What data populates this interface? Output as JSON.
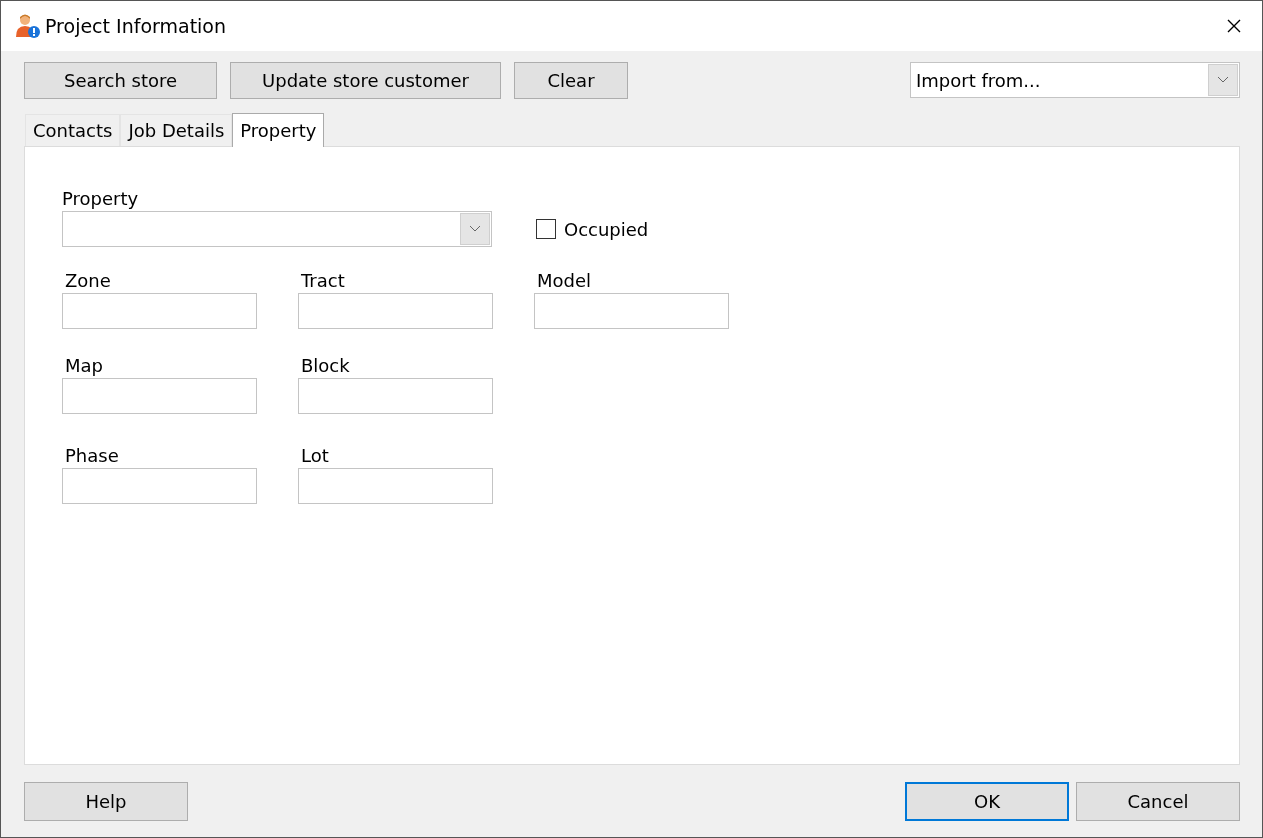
{
  "window": {
    "title": "Project Information"
  },
  "toolbar": {
    "buttons": [
      "Search store",
      "Update store customer",
      "Clear"
    ],
    "import_combo": {
      "value": "Import from..."
    }
  },
  "tabs": [
    {
      "label": "Contacts",
      "selected": false
    },
    {
      "label": "Job Details",
      "selected": false
    },
    {
      "label": "Property",
      "selected": true
    }
  ],
  "property": {
    "label": "Property"
  },
  "occupied": {
    "label": "Occupied",
    "checked": false
  },
  "field_rows": [
    [
      {
        "label": "Zone"
      },
      {
        "label": "Tract"
      },
      {
        "label": "Model"
      }
    ],
    [
      {
        "label": "Map"
      },
      {
        "label": "Block"
      }
    ],
    [
      {
        "label": "Phase"
      },
      {
        "label": "Lot"
      }
    ]
  ],
  "footer": {
    "left": [
      {
        "label": "Help",
        "focused": false
      }
    ],
    "right": [
      {
        "label": "OK",
        "focused": true
      },
      {
        "label": "Cancel",
        "focused": false
      }
    ]
  }
}
